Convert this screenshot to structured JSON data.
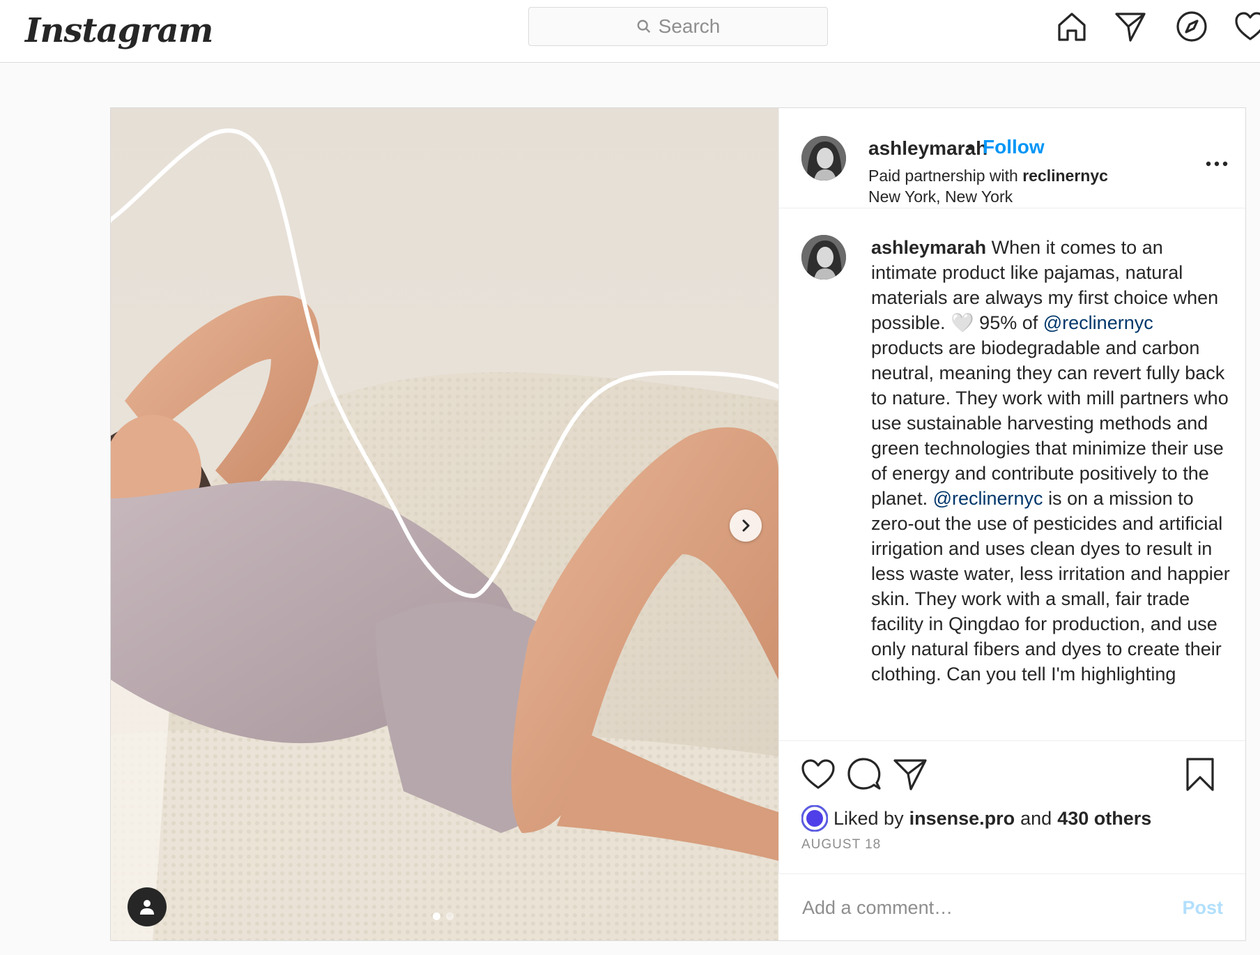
{
  "app": {
    "logo_text": "Instagram"
  },
  "search": {
    "placeholder": "Search"
  },
  "nav": {
    "icons": [
      "home-icon",
      "direct-icon",
      "explore-icon",
      "activity-icon"
    ]
  },
  "post": {
    "username": "ashleymarah",
    "separator": "•",
    "follow_label": "Follow",
    "partnership_prefix": "Paid partnership with",
    "partner": "reclinernyc",
    "location": "New York, New York",
    "caption": {
      "username": "ashleymarah",
      "part1": "When it comes to an intimate product like pajamas, natural materials are always my first choice when possible. 🤍 95% of",
      "mention1": "@reclinernyc",
      "part2": "products are biodegradable and carbon neutral, meaning they can revert fully back to nature. They work with mill partners who use sustainable harvesting methods and green technologies that minimize their use of energy and contribute positively to the planet.",
      "mention2": "@reclinernyc",
      "part3": "is on a mission to zero-out the use of pesticides and artificial irrigation and uses clean dyes to result in less waste water, less irritation and happier skin. They work with a small, fair trade facility in Qingdao for production, and use only natural fibers and dyes to create their clothing. Can you tell I'm highlighting"
    },
    "likes": {
      "prefix": "Liked by",
      "first_liker": "insense.pro",
      "conjunction": "and",
      "others": "430 others"
    },
    "date": "AUGUST 18",
    "comment": {
      "placeholder": "Add a comment…",
      "post_label": "Post"
    },
    "carousel": {
      "slides": 2,
      "active_index": 0
    },
    "colors": {
      "link": "#0095f6",
      "mention": "#00376b",
      "muted": "#8e8e8e",
      "post_disabled": "#b2dffc"
    }
  }
}
